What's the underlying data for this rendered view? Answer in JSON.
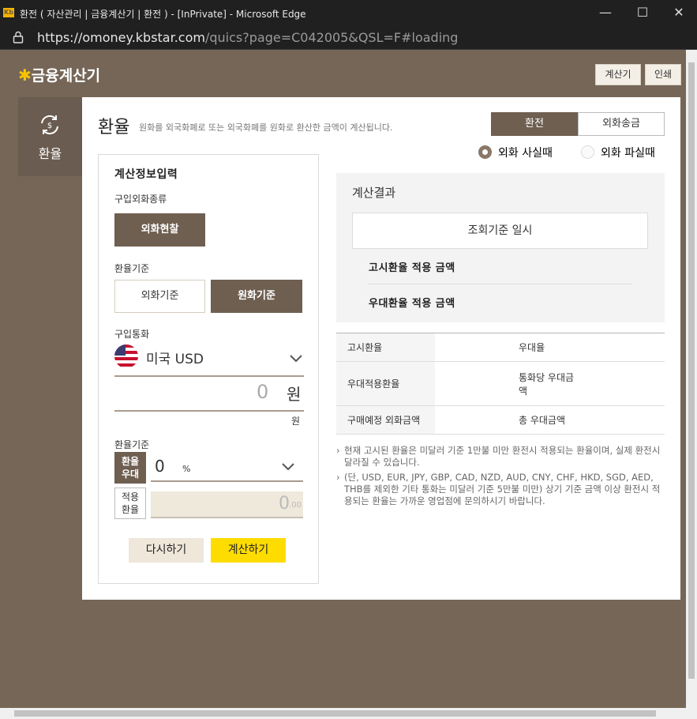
{
  "window": {
    "title": "환전 ( 자산관리 | 금융계산기 | 환전 ) - [InPrivate] - Microsoft Edge",
    "favicon_text": "Kb",
    "controls": {
      "minimize": "—",
      "maximize": "☐",
      "close": "✕"
    }
  },
  "address": {
    "url_host": "https://omoney.kbstar.com",
    "url_rest": "/quics?page=C042005&QSL=F#loading"
  },
  "header": {
    "logo_star": "✱",
    "logo_text": "금융계산기",
    "btn_calc": "계산기",
    "btn_print": "인쇄"
  },
  "side": {
    "tab_label": "환율",
    "tab_icon": "exchange-icon"
  },
  "main": {
    "title": "환율",
    "desc": "원화를 외국화폐로 또는 외국화폐를 원화로 환산한 금액이 계산됩니다.",
    "tabs": [
      {
        "label": "환전",
        "active": true
      },
      {
        "label": "외화송금",
        "active": false
      }
    ],
    "radios": [
      {
        "label": "외화 사실때",
        "checked": true
      },
      {
        "label": "외화 파실때",
        "checked": false
      }
    ]
  },
  "form": {
    "section_title": "계산정보입력",
    "purchase_type_label": "구입외화종류",
    "purchase_type_btn": "외화현찰",
    "rate_basis_label": "환율기준",
    "basis_foreign": "외화기준",
    "basis_won": "원화기준",
    "currency_label": "구입통화",
    "currency_value": "미국 USD",
    "amount_value": "0",
    "amount_unit": "원",
    "amount_subunit": "원",
    "rate_basis_label2": "환율기준",
    "pref_label_1": "환율",
    "pref_label_2": "우대",
    "pref_value": "0",
    "pref_unit": "%",
    "applied_label_1": "적용",
    "applied_label_2": "환율",
    "applied_value": "0",
    "applied_decimal": ".00",
    "reset_btn": "다시하기",
    "calc_btn": "계산하기"
  },
  "result": {
    "title": "계산결과",
    "date_label": "조회기준 일시",
    "notice_amount": "고시환율 적용 금액",
    "pref_amount": "우대환율 적용 금액"
  },
  "rates_table": [
    [
      "고시환율",
      "",
      "우대율",
      ""
    ],
    [
      "우대적용환율",
      "",
      "통화당 우대금액",
      ""
    ],
    [
      "구매예정 외화금액",
      "",
      "총 우대금액",
      ""
    ]
  ],
  "notes": [
    "현재 고시된 환율은 미달러 기준 1만불 미만 환전시 적용되는 환율이며, 실제 환전시 달라질 수 있습니다.",
    "(단, USD, EUR, JPY, GBP, CAD, NZD, AUD, CNY, CHF, HKD, SGD, AED, THB를 제외한 기타 통화는 미달러 기준 5만불 미만) 상기 기준 금액 이상 환전시 적용되는 환율는 가까운 영업점에 문의하시기 바랍니다."
  ],
  "colors": {
    "brand_brown": "#756658",
    "accent_yellow": "#ffdc00",
    "button_brown": "#6f5f51"
  }
}
